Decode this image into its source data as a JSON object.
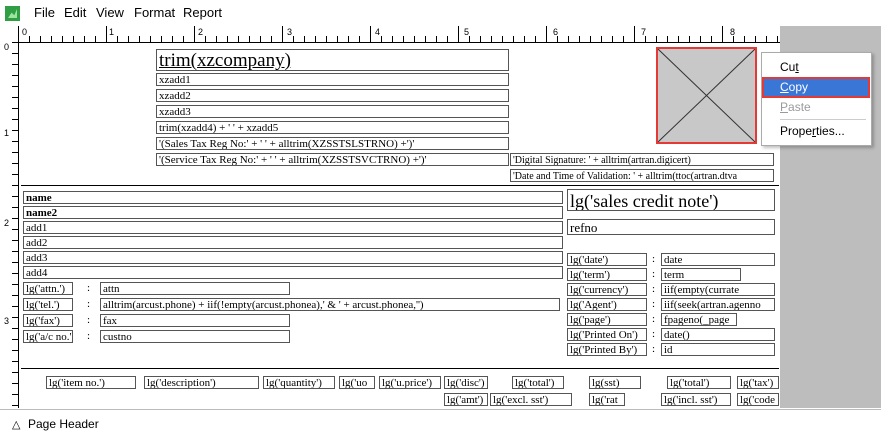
{
  "menu": [
    "File",
    "Edit",
    "View",
    "Format",
    "Report"
  ],
  "ruler": {
    "top": [
      "0",
      "1",
      "2",
      "3",
      "4",
      "5",
      "6",
      "7",
      "8"
    ],
    "side": [
      "0",
      "1",
      "2",
      "3"
    ]
  },
  "header": {
    "company": "trim(xzcompany)",
    "addr1": "xzadd1",
    "addr2": "xzadd2",
    "addr3": "xzadd3",
    "addr45": "trim(xzadd4) + ' ' + xzadd5",
    "sstl": "'(Sales Tax Reg No:' + ' ' + alltrim(XZSSTSLSTRNO) +')'",
    "sstv": "'(Service Tax Reg No:' + ' ' + alltrim(XZSSTSVCTRNO) +')'",
    "digsig": "'Digital Signature: ' + alltrim(artran.digicert)",
    "datetime": "'Date and Time of Validation: ' + alltrim(ttoc(artran.dtva"
  },
  "customer": {
    "name": "name",
    "name2": "name2",
    "add1": "add1",
    "add2": "add2",
    "add3": "add3",
    "add4": "add4",
    "attn_label": "lg('attn.')",
    "attn": "attn",
    "tel_label": "lg('tel.')",
    "tel": "alltrim(arcust.phone) + iif(!empty(arcust.phonea),' & ' + arcust.phonea,'')",
    "fax_label": "lg('fax')",
    "fax": "fax",
    "acno_label": "lg('a/c no.')",
    "acno": "custno",
    "colon": ":"
  },
  "doc": {
    "title": "lg('sales credit note')",
    "refno": "refno",
    "labels": [
      "lg('date')",
      "lg('term')",
      "lg('currency')",
      "lg('Agent')",
      "lg('page')",
      "lg('Printed On')",
      "lg('Printed By')"
    ],
    "values": [
      "date",
      "term",
      "iif(empty(currate",
      "iif(seek(artran.agenno",
      "fpageno(_page",
      "date()",
      "id"
    ]
  },
  "columns": {
    "row1": [
      "lg('item no.')",
      "lg('description')",
      "lg('quantity')",
      "lg('uo",
      "lg('u.price')",
      "lg('disc')",
      "lg('total')",
      "lg(sst)",
      "lg('total')",
      "lg('tax')"
    ],
    "row2": [
      "lg('amt')",
      "lg('excl. sst')",
      "lg('rat",
      "lg('incl. sst')",
      "lg('code"
    ]
  },
  "context_menu": {
    "items": [
      "Cut",
      "Copy",
      "Paste",
      "Properties..."
    ]
  },
  "status": {
    "band": "Page Header"
  }
}
